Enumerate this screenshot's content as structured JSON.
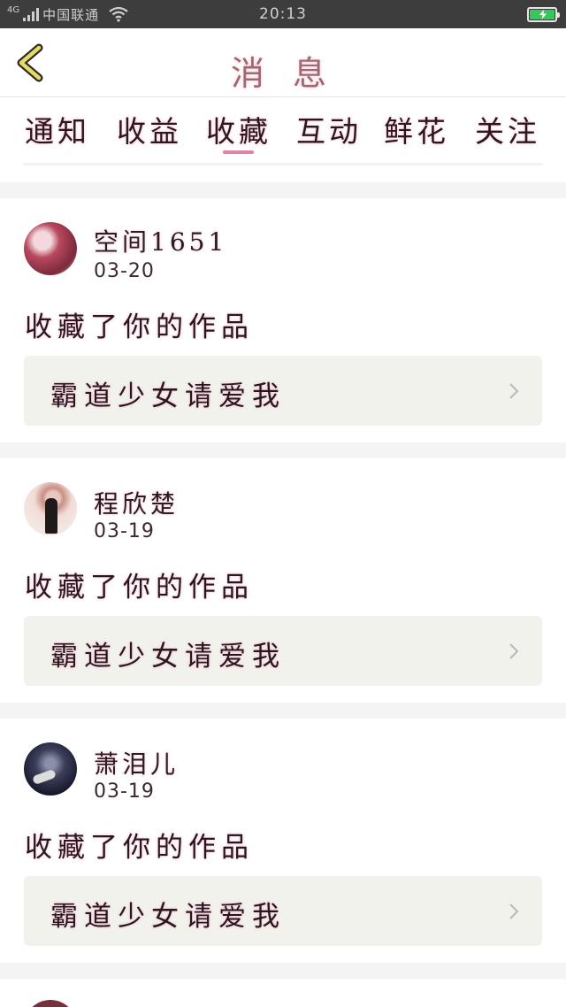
{
  "status_bar": {
    "network_type": "4G",
    "carrier": "中国联通",
    "time": "20:13",
    "battery_level": 1.0,
    "battery_charging": true,
    "battery_color": "#35c759"
  },
  "header": {
    "back_icon": "chevron-left-icon",
    "title": "消 息"
  },
  "tabs": {
    "items": [
      {
        "label": "通知",
        "active": false
      },
      {
        "label": "收益",
        "active": false
      },
      {
        "label": "收藏",
        "active": true
      },
      {
        "label": "互动",
        "active": false
      },
      {
        "label": "鲜花",
        "active": false
      },
      {
        "label": "关注",
        "active": false
      }
    ],
    "active_color": "#e283a8"
  },
  "messages": [
    {
      "user": "空间1651",
      "date": "03-20",
      "action": "收藏了你的作品",
      "work_title": "霸道少女请爱我"
    },
    {
      "user": "程欣楚",
      "date": "03-19",
      "action": "收藏了你的作品",
      "work_title": "霸道少女请爱我"
    },
    {
      "user": "萧泪儿",
      "date": "03-19",
      "action": "收藏了你的作品",
      "work_title": "霸道少女请爱我"
    }
  ]
}
